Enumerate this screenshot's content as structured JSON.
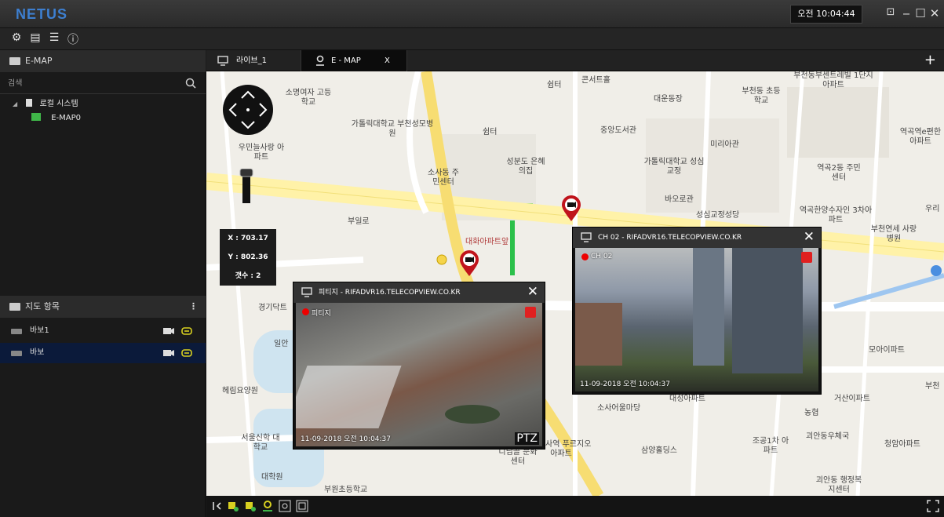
{
  "app": {
    "title": "NETUS",
    "clock": "오전 10:04:44"
  },
  "sidebar": {
    "emap_header": "E-MAP",
    "search_placeholder": "검색",
    "tree": {
      "root": "로컬 시스템",
      "child": "E-MAP0"
    },
    "map_items_header": "지도 항목",
    "map_items": [
      {
        "label": "바보1",
        "selected": false
      },
      {
        "label": "바보",
        "selected": true
      }
    ]
  },
  "tabs": [
    {
      "label": "라이브_1",
      "active": false
    },
    {
      "label": "E - MAP",
      "active": true,
      "close": "X"
    }
  ],
  "map": {
    "coords": {
      "x": "X : 703.17",
      "y": "Y : 802.36",
      "count": "갯수 : 2"
    },
    "labels": [
      "콘서트홀",
      "소명여자 고등학교",
      "가톨릭대학교 부천성모병원",
      "쉼터",
      "쉼터",
      "대운동장",
      "부천동 초등학교",
      "중앙도서관",
      "미리아관",
      "역곡역e편한 아파트",
      "가톨릭대학교 성심교정",
      "역곡2동 주민센터",
      "성분도 은혜의집",
      "소사동 주민센터",
      "우민늘사랑 아파트",
      "바오로관",
      "역곡한양수자인 3차아파트",
      "부천연세 사랑병원",
      "우리",
      "부일로",
      "대화아파트앞",
      "경기닥트",
      "일안",
      "헤림요양원",
      "서울신학 대학교",
      "대학원",
      "부원초등학교",
      "천소사역 푸르지오아파트",
      "디님골 문화센터",
      "삼양홀딩스",
      "조공1차 아파트",
      "괴안동우체국",
      "청암아파트",
      "거산이파트",
      "모아이파트",
      "대성아파트",
      "소사어울마당",
      "성심교정성당",
      "부천동부센트레빌 1단지아파트",
      "괴안동 행정복지센터",
      "농협",
      "부천"
    ]
  },
  "cameras": [
    {
      "title": "피티지 - RIFADVR16.TELECOPVIEW.CO.KR",
      "name": "피티지",
      "timestamp": "11-09-2018  오전 10:04:37",
      "ptz": "PTZ"
    },
    {
      "title": "CH 02 - RIFADVR16.TELECOPVIEW.CO.KR",
      "name": "CH 02",
      "timestamp": "11-09-2018  오전 10:04:37"
    }
  ],
  "colors": {
    "accent": "#3d7fd0",
    "marker": "#c0141c",
    "selected_row": "#0b1a3a"
  }
}
